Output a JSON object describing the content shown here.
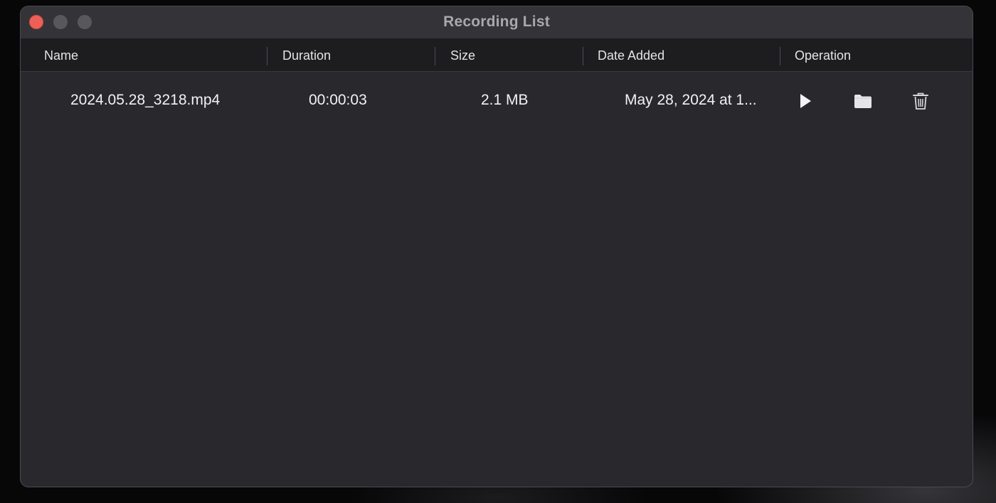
{
  "window": {
    "title": "Recording List"
  },
  "table": {
    "columns": [
      "Name",
      "Duration",
      "Size",
      "Date Added",
      "Operation"
    ],
    "rows": [
      {
        "name": "2024.05.28_3218.mp4",
        "duration": "00:00:03",
        "size": "2.1 MB",
        "date_added": "May 28, 2024 at 1...",
        "operations": [
          "play-icon",
          "folder-icon",
          "trash-icon"
        ]
      }
    ]
  },
  "colors": {
    "close": "#ee5f57",
    "window_bg": "#28282d",
    "header_bg": "#1d1d20"
  }
}
